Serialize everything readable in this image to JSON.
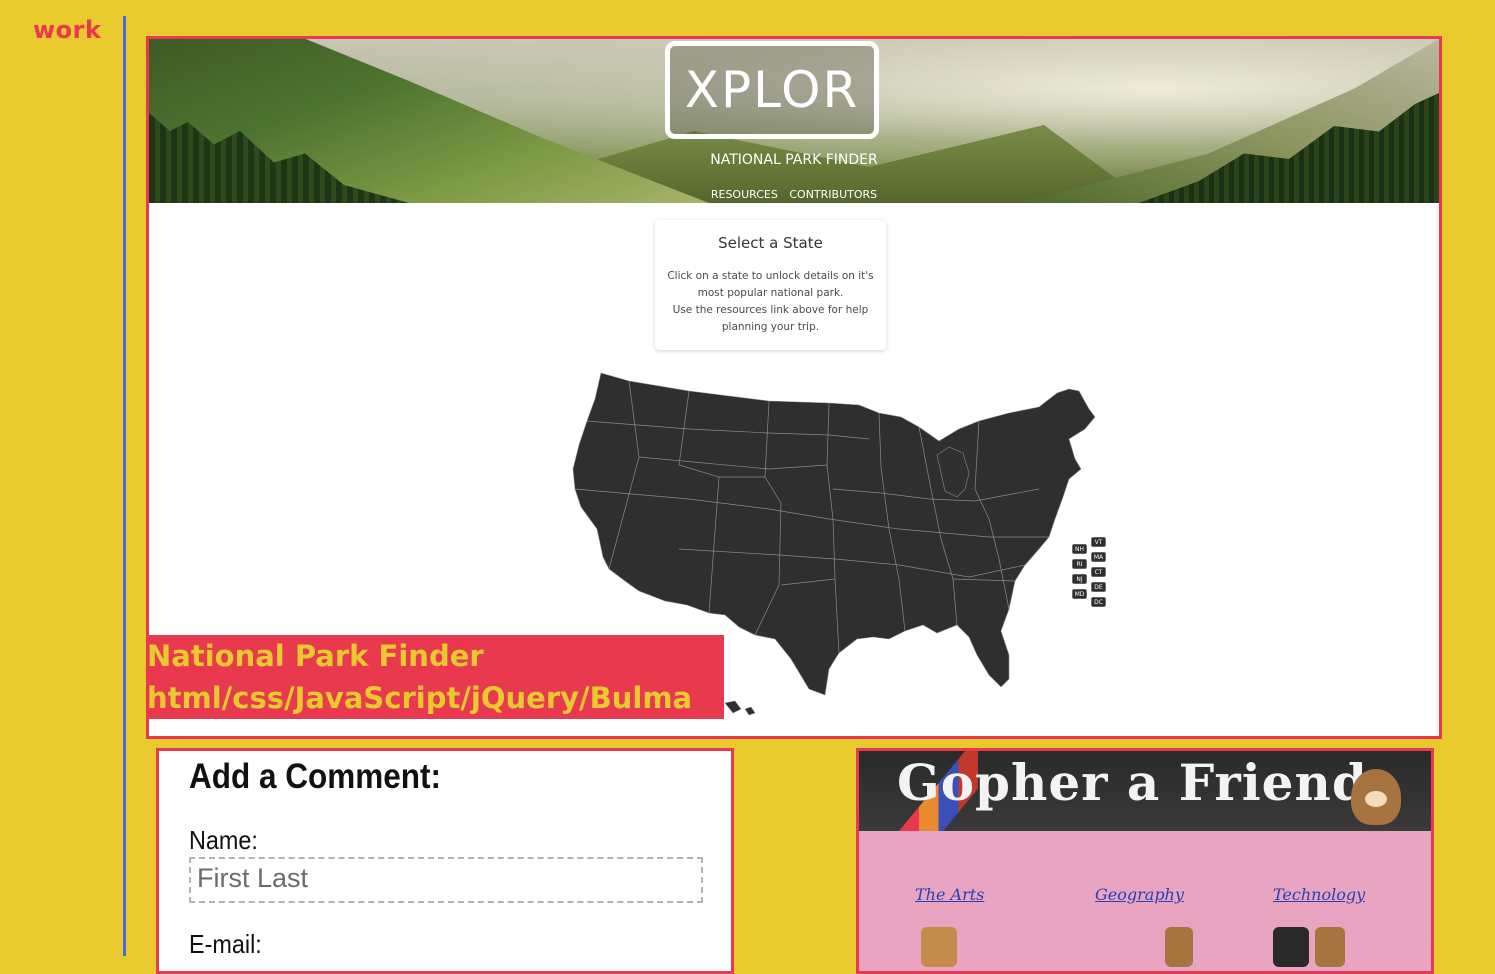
{
  "side_label": "work",
  "project": {
    "logo": "XPLOR",
    "subtitle": "NATIONAL PARK FINDER",
    "nav": [
      "RESOURCES",
      "CONTRIBUTORS"
    ],
    "info": {
      "title": "Select a State",
      "line1": "Click on a state to unlock details on it's most popular national park.",
      "line2": "Use the resources link above for help planning your trip."
    },
    "small_state_labels": [
      "VT",
      "NH",
      "MA",
      "RI",
      "CT",
      "NJ",
      "DE",
      "MD",
      "DC"
    ]
  },
  "caption": {
    "title": "National Park Finder",
    "tech": "html/css/JavaScript/jQuery/Bulma"
  },
  "comment": {
    "heading": "Add a Comment:",
    "name_label": "Name:",
    "name_placeholder": "First Last",
    "email_label": "E-mail:"
  },
  "gopher": {
    "title": "Gopher a Friend",
    "links": [
      "The Arts",
      "Geography",
      "Technology"
    ]
  },
  "colors": {
    "background": "#e8c92e",
    "accent_red": "#e8394f",
    "divider_blue": "#4a6bd8",
    "gopher_pink": "#e9a4c1",
    "map_fill": "#2f2f2f"
  }
}
